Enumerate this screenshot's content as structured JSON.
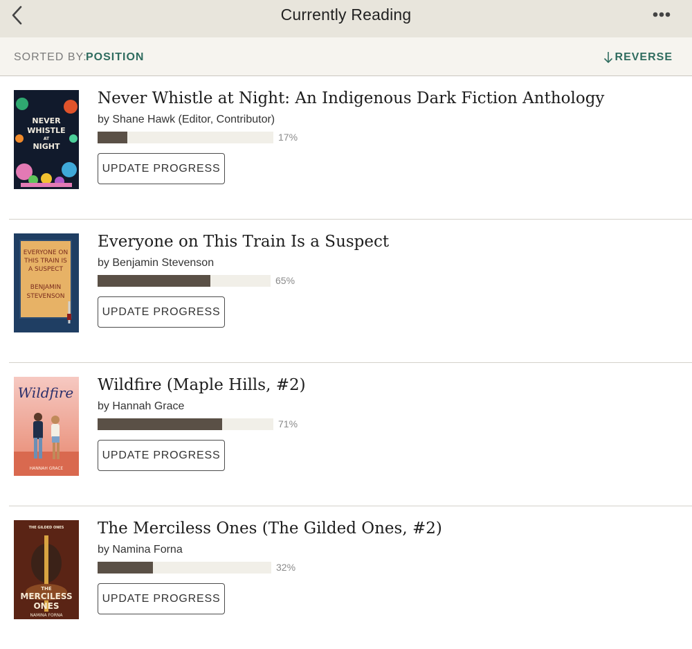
{
  "header": {
    "title": "Currently Reading",
    "back_icon": "chevron-left-icon",
    "more_icon": "more-dots-icon"
  },
  "sort": {
    "label": "SORTED BY:",
    "value": "POSITION",
    "reverse_label": "REVERSE",
    "reverse_icon": "arrow-down-icon"
  },
  "colors": {
    "accent": "#2f6c5f",
    "progress_fill": "#5a5046",
    "progress_track": "#f1efe8",
    "header_bg": "#e8e5dc"
  },
  "books": [
    {
      "title": "Never Whistle at Night: An Indigenous Dark Fiction Anthology",
      "author": "by Shane Hawk (Editor, Contributor)",
      "progress": 17,
      "progress_label": "17%",
      "button": "UPDATE PROGRESS",
      "cover_text": [
        "NEVER",
        "WHISTLE",
        "AT",
        "NIGHT"
      ]
    },
    {
      "title": "Everyone on This Train Is a Suspect",
      "author": "by Benjamin Stevenson",
      "progress": 65,
      "progress_label": "65%",
      "button": "UPDATE PROGRESS",
      "cover_text": [
        "EVERYONE ON",
        "THIS TRAIN IS",
        "A SUSPECT",
        "BENJAMIN",
        "STEVENSON"
      ]
    },
    {
      "title": "Wildfire (Maple Hills, #2)",
      "author": "by Hannah Grace",
      "progress": 71,
      "progress_label": "71%",
      "button": "UPDATE PROGRESS",
      "cover_text": [
        "Wildfire",
        "HANNAH GRACE"
      ]
    },
    {
      "title": "The Merciless Ones (The Gilded Ones, #2)",
      "author": "by Namina Forna",
      "progress": 32,
      "progress_label": "32%",
      "button": "UPDATE PROGRESS",
      "cover_text": [
        "THE GILDED ONES",
        "THE",
        "MERCILESS",
        "ONES",
        "NAMINA FORNA"
      ]
    }
  ]
}
